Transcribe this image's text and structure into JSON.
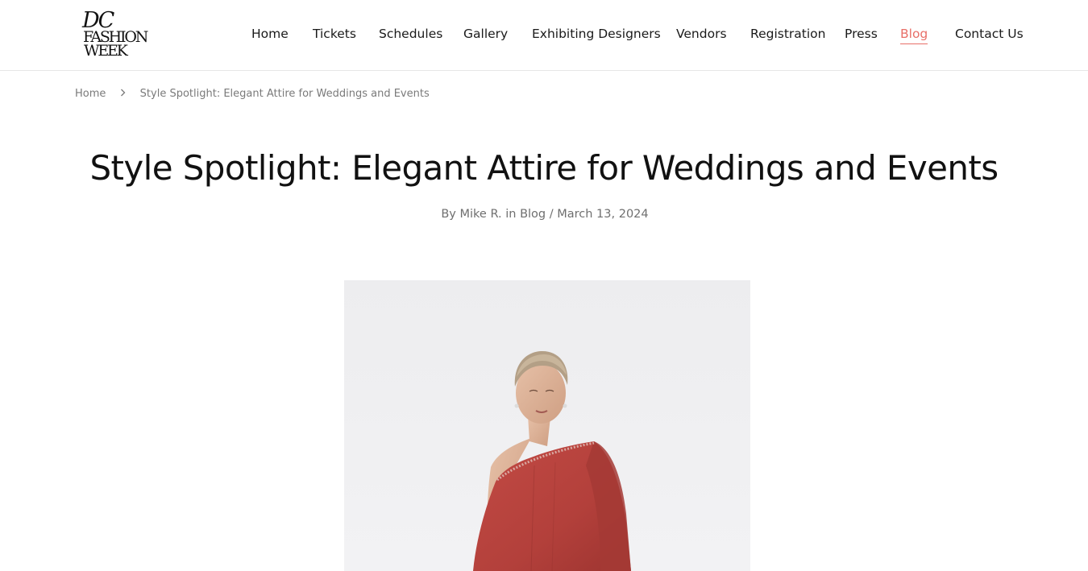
{
  "brand": {
    "logo_line1": "DC",
    "logo_line2": "FASHION",
    "logo_line3": "WEEK"
  },
  "nav": {
    "items": [
      {
        "label": "Home"
      },
      {
        "label": "Tickets"
      },
      {
        "label": "Schedules"
      },
      {
        "label": "Gallery"
      },
      {
        "label": "Exhibiting Designers"
      },
      {
        "label": "Vendors"
      },
      {
        "label": "Registration"
      },
      {
        "label": "Press"
      },
      {
        "label": "Blog",
        "active": true
      },
      {
        "label": "Contact Us"
      }
    ],
    "active_color": "#e86f68"
  },
  "breadcrumb": {
    "home": "Home",
    "separator_icon": "chevron-right-icon",
    "current": "Style Spotlight: Elegant Attire for Weddings and Events"
  },
  "post": {
    "title": "Style Spotlight: Elegant Attire for Weddings and Events",
    "by": "By",
    "author": "Mike R.",
    "in": "in",
    "category": "Blog",
    "date_separator": "/",
    "date": "March 13, 2024"
  },
  "hero_image": {
    "subject": "model-in-red-one-shoulder-gown",
    "dress_color": "#b7443f"
  }
}
